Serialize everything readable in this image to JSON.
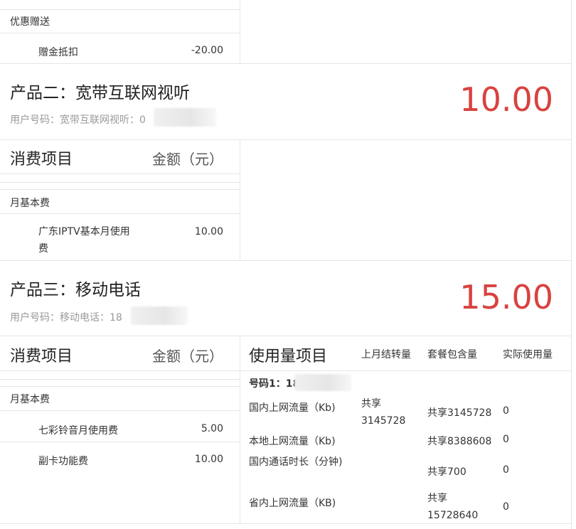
{
  "product1": {
    "section_label": "优惠赠送",
    "items": [
      {
        "name": "赠金抵扣",
        "amount": "-20.00"
      }
    ]
  },
  "product2": {
    "title": "产品二：宽带互联网视听",
    "user_label": "用户号码：宽带互联网视听：0",
    "total": "10.00",
    "col_item": "消费项目",
    "col_amount": "金额（元）",
    "section_label": "月基本费",
    "items": [
      {
        "name": "广东IPTV基本月使用费",
        "amount": "10.00"
      }
    ]
  },
  "product3": {
    "title": "产品三：移动电话",
    "user_label": "用户号码：移动电话：18",
    "total": "15.00",
    "col_item": "消费项目",
    "col_amount": "金额（元）",
    "section_label": "月基本费",
    "items": [
      {
        "name": "七彩铃音月使用费",
        "amount": "5.00"
      },
      {
        "name": "副卡功能费",
        "amount": "10.00"
      }
    ],
    "usage": {
      "title": "使用量项目",
      "headers": [
        "上月结转量",
        "套餐包含量",
        "实际使用量"
      ],
      "number_label": "号码1：18",
      "rows": [
        {
          "name": "国内上网流量（Kb)",
          "carry": "共享3145728",
          "included": "共享3145728",
          "used": "0"
        },
        {
          "name": "本地上网流量（Kb)",
          "carry": "",
          "included": "共享8388608",
          "used": "0"
        },
        {
          "name": "国内通话时长（分钟)",
          "carry": "",
          "included": "共享700",
          "used": "0"
        },
        {
          "name": "省内上网流量（KB)",
          "carry": "",
          "included": "共享15728640",
          "used": "0"
        }
      ]
    }
  }
}
